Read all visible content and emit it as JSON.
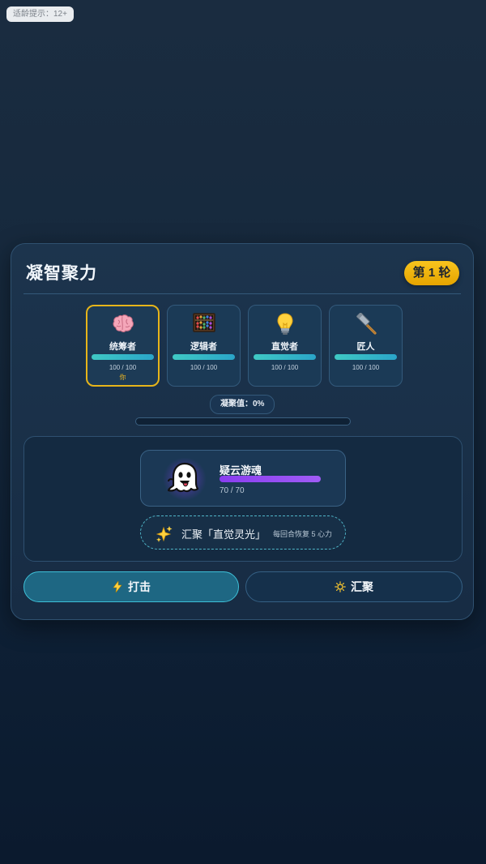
{
  "age_rating": "适龄提示：12+",
  "panel": {
    "title": "凝智聚力",
    "round_badge": "第 1 轮"
  },
  "heroes": [
    {
      "name": "统筹者",
      "hp": "100 / 100",
      "hp_fraction": 1.0,
      "icon": "brain-icon",
      "tag": "你",
      "selected": true
    },
    {
      "name": "逻辑者",
      "hp": "100 / 100",
      "hp_fraction": 1.0,
      "icon": "abacus-icon",
      "selected": false
    },
    {
      "name": "直觉者",
      "hp": "100 / 100",
      "hp_fraction": 1.0,
      "icon": "lightbulb-icon",
      "selected": false
    },
    {
      "name": "匠人",
      "hp": "100 / 100",
      "hp_fraction": 1.0,
      "icon": "hammer-icon",
      "selected": false
    }
  ],
  "condensation": {
    "label": "凝聚值：0%",
    "fraction": 0.0
  },
  "enemy": {
    "name": "疑云游魂",
    "hp": "70 / 70",
    "hp_fraction": 1.0,
    "icon": "ghost-icon"
  },
  "skill": {
    "icon": "sparkles-icon",
    "label": "汇聚「直觉灵光」",
    "note": "每回合恢复 5 心力"
  },
  "actions": {
    "attack_label": "打击",
    "attack_icon": "lightning-icon",
    "gather_label": "汇聚",
    "gather_icon": "sun-icon"
  },
  "colors": {
    "accent_gold": "#e7b51a",
    "hp_teal": "#3fc9c4",
    "enemy_purple": "#8a3df0",
    "attack_button": "#1e6783"
  }
}
